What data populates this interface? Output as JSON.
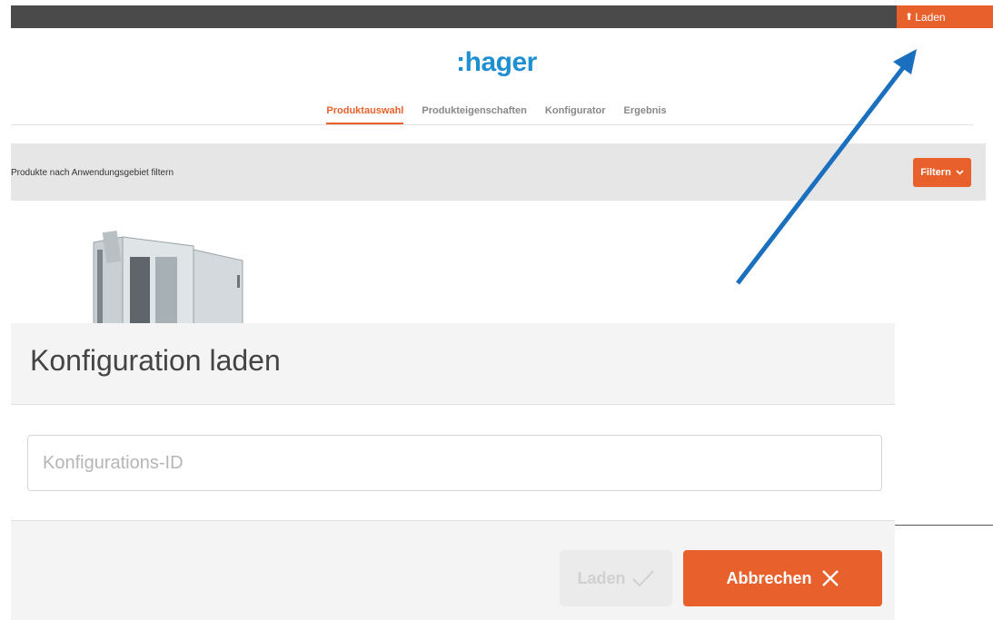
{
  "topbar": {
    "load_label": "Laden",
    "load_icon": "upload-icon"
  },
  "logo": {
    "text": ":hager",
    "color": "#1e8fd0"
  },
  "tabs": [
    {
      "label": "Produktauswahl",
      "active": true
    },
    {
      "label": "Produkteigenschaften",
      "active": false
    },
    {
      "label": "Konfigurator",
      "active": false
    },
    {
      "label": "Ergebnis",
      "active": false
    }
  ],
  "filter_bar": {
    "text": "Produkte nach Anwendungsgebiet filtern",
    "button_label": "Filtern",
    "button_icon": "chevron-down-icon"
  },
  "modal": {
    "title": "Konfiguration laden",
    "input_placeholder": "Konfigurations-ID",
    "input_value": "",
    "load_button_label": "Laden",
    "load_button_icon": "checkmark-icon",
    "cancel_button_label": "Abbrechen",
    "cancel_button_icon": "close-icon"
  },
  "colors": {
    "accent": "#e8612c",
    "topbar": "#4a4a4a",
    "annotation_arrow": "#1a6fbf"
  }
}
